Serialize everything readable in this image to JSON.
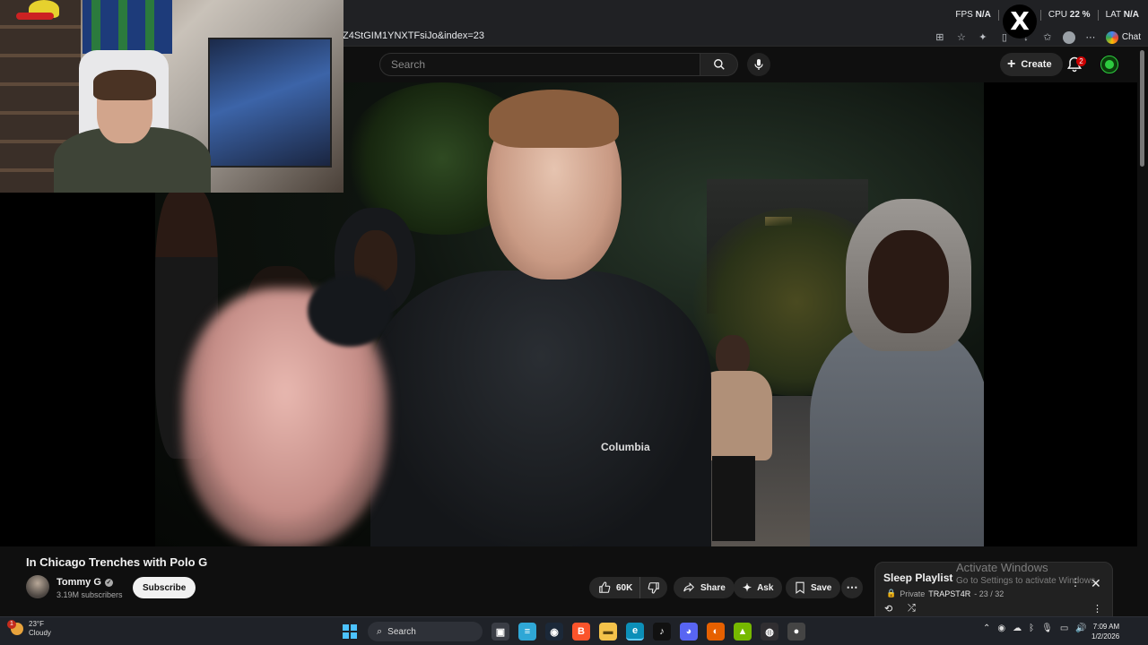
{
  "browser": {
    "url": "Z4StGIM1YNXTFsiJo&index=23",
    "chat_label": "Chat"
  },
  "overlay_stats": {
    "fps_label": "FPS",
    "fps_value": "N/A",
    "gpu_label": "G",
    "cpu_label": "CPU",
    "cpu_value": "22 %",
    "lat_label": "LAT",
    "lat_value": "N/A",
    "x_logo": "X"
  },
  "youtube_header": {
    "search_placeholder": "Search",
    "create_label": "Create",
    "notification_count": "2"
  },
  "video": {
    "jacket_logo": "Columbia",
    "title": "In Chicago Trenches with Polo G",
    "channel_name": "Tommy G",
    "subscribers": "3.19M subscribers",
    "subscribe_label": "Subscribe",
    "like_count": "60K",
    "share_label": "Share",
    "ask_label": "Ask",
    "save_label": "Save"
  },
  "playlist": {
    "title": "Sleep Playlist",
    "privacy": "Private",
    "owner": "TRAPST4R",
    "position": "- 23 / 32"
  },
  "watermark": {
    "line1": "Activate Windows",
    "line2": "Go to Settings to activate Windows."
  },
  "taskbar": {
    "weather_temp": "23°F",
    "weather_desc": "Cloudy",
    "weather_badge": "1",
    "search_label": "Search",
    "time": "7:09 AM",
    "date": "1/2/2026"
  }
}
